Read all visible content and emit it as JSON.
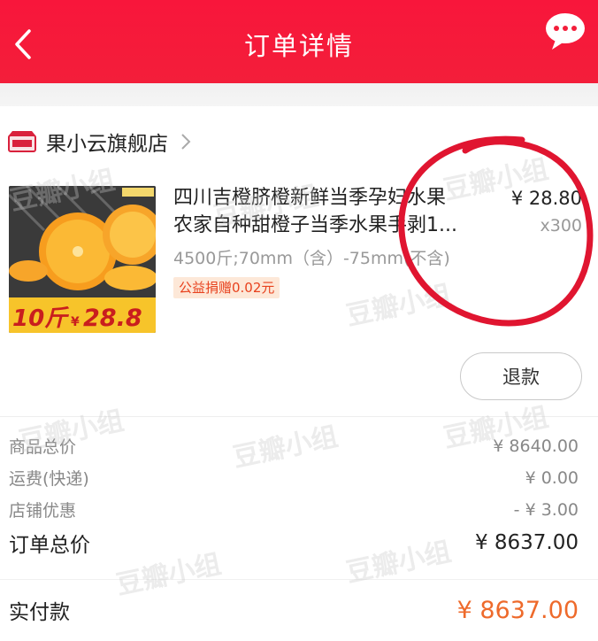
{
  "header": {
    "title": "订单详情",
    "bg_color": "#f31e3a"
  },
  "shop": {
    "name": "果小云旗舰店"
  },
  "product": {
    "name_line1": "四川吉橙脐橙新鲜当季孕妇水果",
    "name_line2": "农家自种甜橙子当季水果手剥1...",
    "spec": "4500斤;70mm（含）-75mm(不含)",
    "badge": "公益捐赠0.02元",
    "price": "¥ 28.80",
    "qty": "x300",
    "image_text_weight": "10斤",
    "image_text_price_prefix": "¥",
    "image_text_price": "28.8"
  },
  "actions": {
    "refund_label": "退款"
  },
  "summary": {
    "goods_total_label": "商品总价",
    "goods_total_value": "¥ 8640.00",
    "shipping_label": "运费(快递)",
    "shipping_value": "¥ 0.00",
    "discount_label": "店铺优惠",
    "discount_value": "- ¥ 3.00",
    "order_total_label": "订单总价",
    "order_total_value": "¥ 8637.00",
    "paid_label": "实付款",
    "paid_value": "¥ 8637.00"
  },
  "watermark": {
    "text": "豆瓣小组"
  },
  "colors": {
    "accent": "#f31e3a",
    "paid": "#ee6a2b",
    "annotation": "#e01530"
  },
  "icons": [
    "back-arrow-icon",
    "chat-bubble-icon",
    "shop-icon",
    "chevron-right-icon"
  ]
}
